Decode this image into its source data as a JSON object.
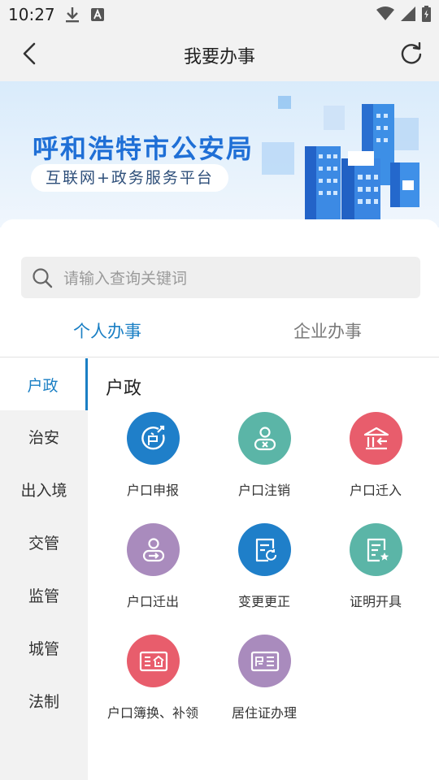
{
  "statusbar": {
    "time": "10:27",
    "icons": [
      "download-icon",
      "font-a-icon",
      "wifi-icon",
      "signal-icon",
      "battery-charging-icon"
    ]
  },
  "navbar": {
    "title": "我要办事",
    "back_icon": "chevron-left-icon",
    "refresh_icon": "refresh-icon"
  },
  "banner": {
    "title": "呼和浩特市公安局",
    "subtitle": "互联网+政务服务平台"
  },
  "search": {
    "placeholder": "请输入查询关键词"
  },
  "tabs": [
    {
      "label": "个人办事",
      "active": true
    },
    {
      "label": "企业办事",
      "active": false
    }
  ],
  "sidebar": {
    "items": [
      {
        "label": "户政",
        "active": true
      },
      {
        "label": "治安",
        "active": false
      },
      {
        "label": "出入境",
        "active": false
      },
      {
        "label": "交管",
        "active": false
      },
      {
        "label": "监管",
        "active": false
      },
      {
        "label": "城管",
        "active": false
      },
      {
        "label": "法制",
        "active": false
      }
    ]
  },
  "section": {
    "title": "户政"
  },
  "services": [
    {
      "label": "户口申报",
      "icon": "household-declare-icon",
      "color": "#1f7fc9"
    },
    {
      "label": "户口注销",
      "icon": "household-cancel-icon",
      "color": "#5bb5a7"
    },
    {
      "label": "户口迁入",
      "icon": "household-move-in-icon",
      "color": "#e85d6c"
    },
    {
      "label": "户口迁出",
      "icon": "household-move-out-icon",
      "color": "#a98bbd"
    },
    {
      "label": "变更更正",
      "icon": "change-correct-icon",
      "color": "#1f7fc9"
    },
    {
      "label": "证明开具",
      "icon": "certificate-issue-icon",
      "color": "#5bb5a7"
    },
    {
      "label": "户口簿换、补领",
      "icon": "household-book-icon",
      "color": "#e85d6c"
    },
    {
      "label": "居住证办理",
      "icon": "residence-permit-icon",
      "color": "#a98bbd"
    }
  ],
  "colors": {
    "accent": "#1a7fc4",
    "banner_title": "#1f6fd6"
  }
}
